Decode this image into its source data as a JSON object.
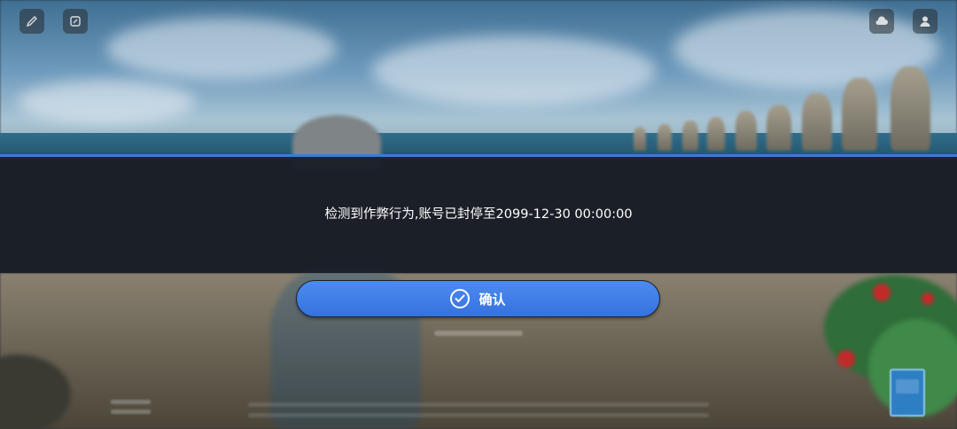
{
  "dialog": {
    "message": "检测到作弊行为,账号已封停至2099-12-30 00:00:00",
    "confirm_label": "确认"
  },
  "icons": {
    "top_left": [
      "edit-icon",
      "notes-icon"
    ],
    "top_right": [
      "cloud-icon",
      "user-icon"
    ],
    "confirm": "check-circle-icon"
  },
  "colors": {
    "accent": "#3d7ad6",
    "button": "#4d8af0",
    "dialog_bg": "#1b1f28"
  }
}
